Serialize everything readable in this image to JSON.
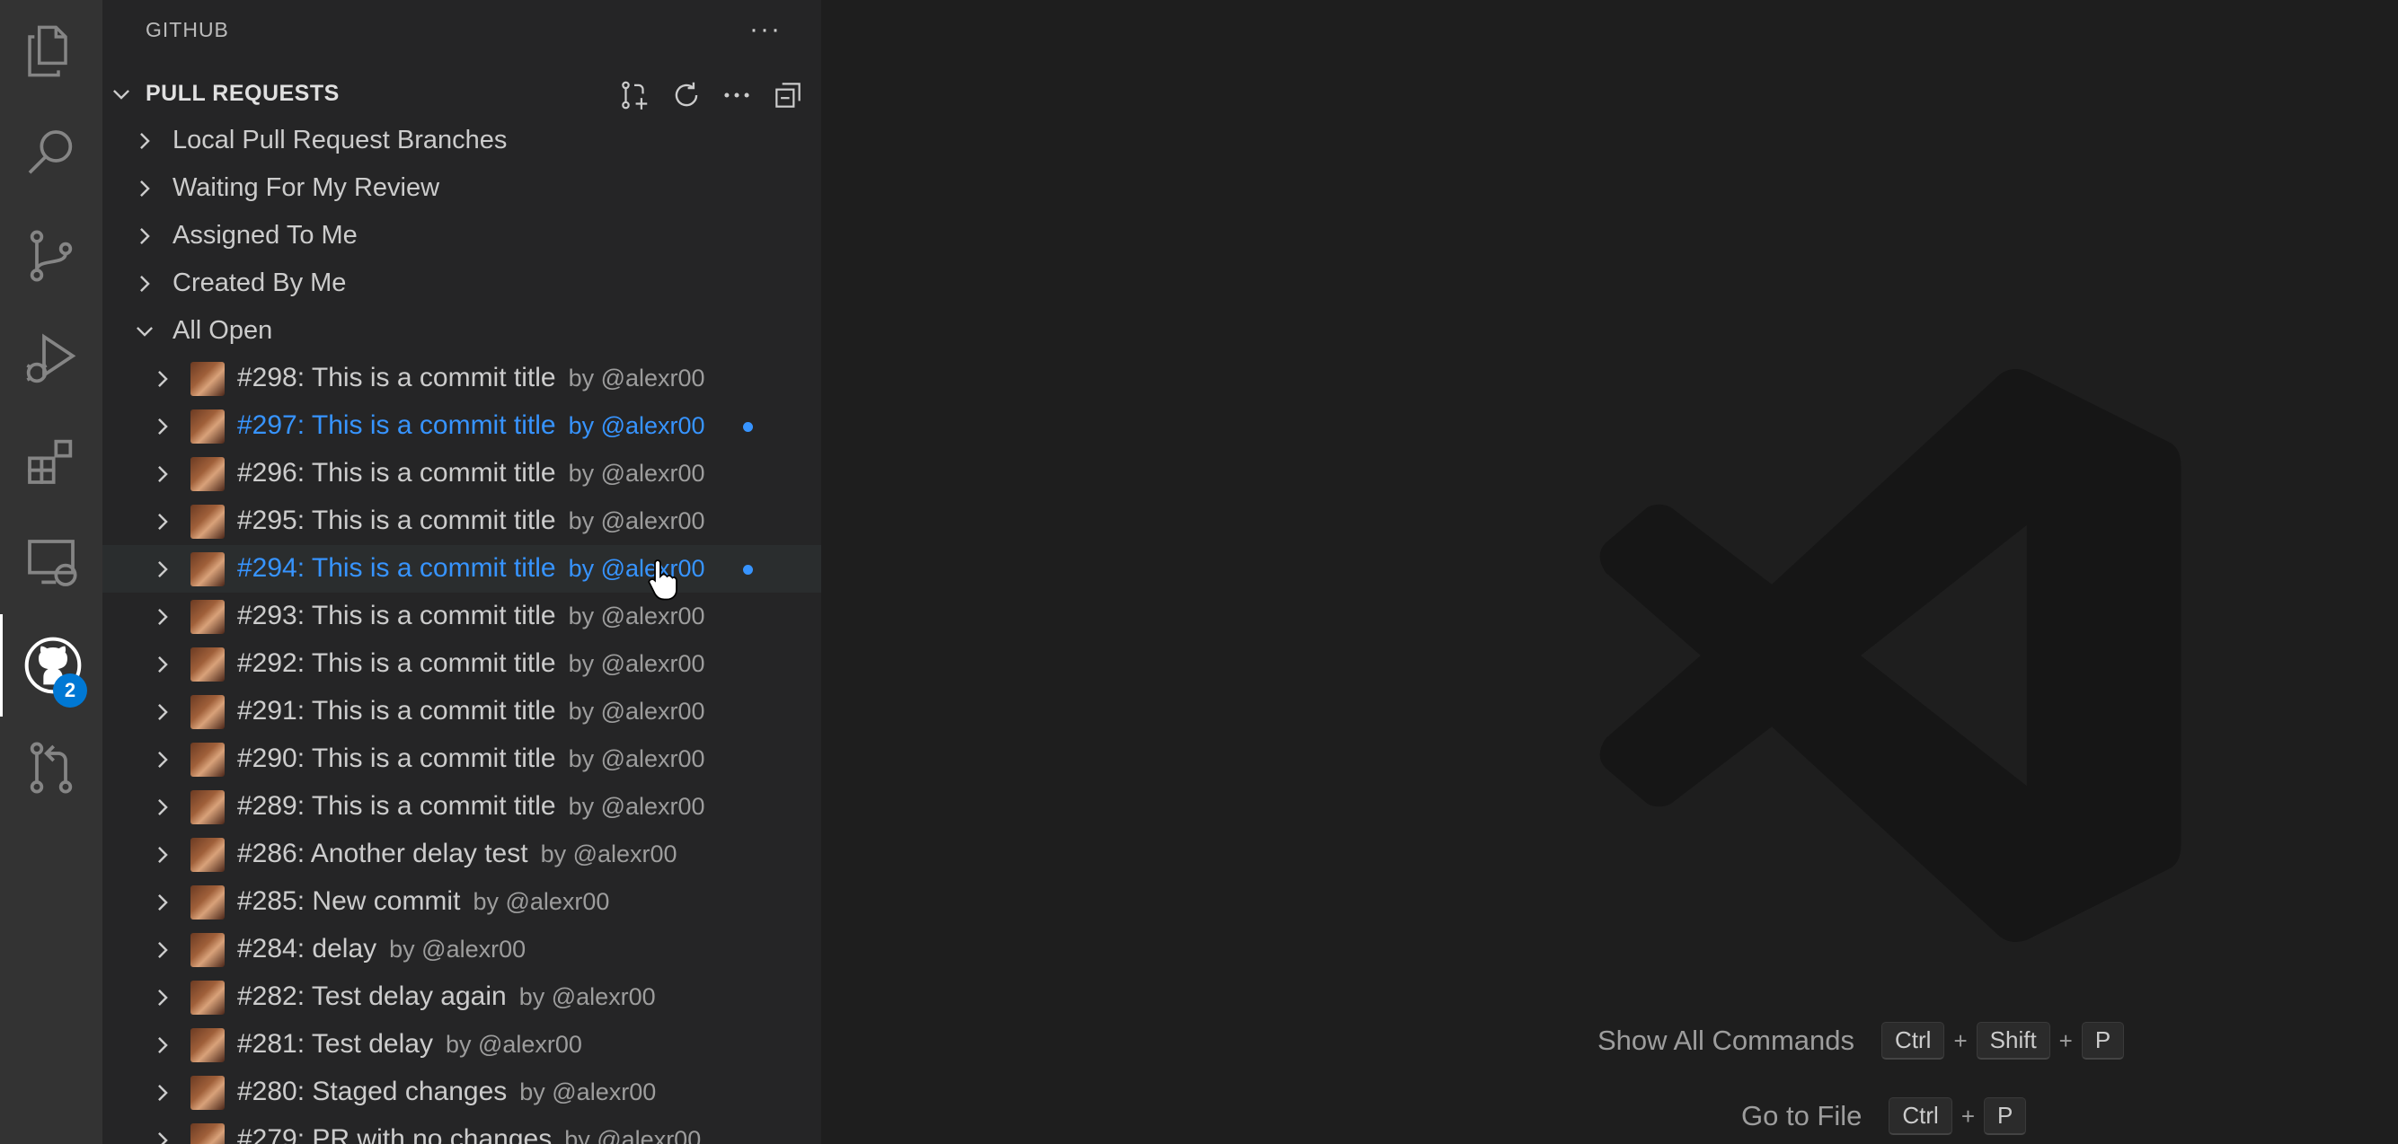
{
  "activity_bar": {
    "icons": [
      "explorer-icon",
      "search-icon",
      "source-control-icon",
      "run-debug-icon",
      "extensions-icon",
      "remote-explorer-icon",
      "github-icon",
      "pull-request-icon"
    ],
    "github_badge": "2"
  },
  "sidebar": {
    "title": "GITHUB",
    "more": "···",
    "section": {
      "title": "PULL REQUESTS",
      "actions": [
        "create-pull-request-icon",
        "refresh-icon",
        "more-actions-icon",
        "collapse-all-icon"
      ]
    },
    "categories": [
      {
        "label": "Local Pull Request Branches"
      },
      {
        "label": "Waiting For My Review"
      },
      {
        "label": "Assigned To Me"
      },
      {
        "label": "Created By Me"
      },
      {
        "label": "All Open"
      }
    ],
    "pull_requests": [
      {
        "title": "#298: This is a commit title",
        "author": "by @alexr00",
        "highlight": false,
        "unread": false
      },
      {
        "title": "#297: This is a commit title",
        "author": "by @alexr00",
        "highlight": true,
        "unread": true
      },
      {
        "title": "#296: This is a commit title",
        "author": "by @alexr00",
        "highlight": false,
        "unread": false
      },
      {
        "title": "#295: This is a commit title",
        "author": "by @alexr00",
        "highlight": false,
        "unread": false
      },
      {
        "title": "#294: This is a commit title",
        "author": "by @alexr00",
        "highlight": true,
        "unread": true
      },
      {
        "title": "#293: This is a commit title",
        "author": "by @alexr00",
        "highlight": false,
        "unread": false
      },
      {
        "title": "#292: This is a commit title",
        "author": "by @alexr00",
        "highlight": false,
        "unread": false
      },
      {
        "title": "#291: This is a commit title",
        "author": "by @alexr00",
        "highlight": false,
        "unread": false
      },
      {
        "title": "#290: This is a commit title",
        "author": "by @alexr00",
        "highlight": false,
        "unread": false
      },
      {
        "title": "#289: This is a commit title",
        "author": "by @alexr00",
        "highlight": false,
        "unread": false
      },
      {
        "title": "#286: Another delay test",
        "author": "by @alexr00",
        "highlight": false,
        "unread": false
      },
      {
        "title": "#285: New commit",
        "author": "by @alexr00",
        "highlight": false,
        "unread": false
      },
      {
        "title": "#284: delay",
        "author": "by @alexr00",
        "highlight": false,
        "unread": false
      },
      {
        "title": "#282: Test delay again",
        "author": "by @alexr00",
        "highlight": false,
        "unread": false
      },
      {
        "title": "#281: Test delay",
        "author": "by @alexr00",
        "highlight": false,
        "unread": false
      },
      {
        "title": "#280: Staged changes",
        "author": "by @alexr00",
        "highlight": false,
        "unread": false
      },
      {
        "title": "#279: PR with no changes",
        "author": "by @alexr00",
        "highlight": false,
        "unread": false
      }
    ]
  },
  "editor": {
    "shortcuts": [
      {
        "label": "Show All Commands",
        "keys": [
          "Ctrl",
          "Shift",
          "P"
        ]
      },
      {
        "label": "Go to File",
        "keys": [
          "Ctrl",
          "P"
        ]
      }
    ]
  },
  "colors": {
    "accent": "#3794ff",
    "activity_bar_bg": "#333333",
    "sidebar_bg": "#252526",
    "editor_bg": "#1e1e1e",
    "badge": "#0078d4"
  }
}
